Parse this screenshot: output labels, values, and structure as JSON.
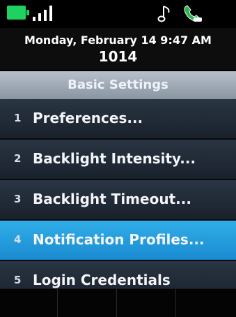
{
  "status_bar": {
    "icons": [
      "battery-icon",
      "signal-icon",
      "music-note-icon",
      "handset-icon"
    ],
    "colors": {
      "battery": "#1fd160",
      "handset": "#2db34a"
    }
  },
  "header": {
    "date_time": "Monday, February 14 9:47 AM",
    "extension": "1014"
  },
  "screen": {
    "title": "Basic Settings"
  },
  "menu": {
    "items": [
      {
        "number": "1",
        "label": "Preferences...",
        "selected": false
      },
      {
        "number": "2",
        "label": "Backlight Intensity...",
        "selected": false
      },
      {
        "number": "3",
        "label": "Backlight Timeout...",
        "selected": false
      },
      {
        "number": "4",
        "label": "Notification Profiles...",
        "selected": true
      },
      {
        "number": "5",
        "label": "Login Credentials",
        "selected": false
      }
    ],
    "selected_color": "#1fa0e0"
  }
}
